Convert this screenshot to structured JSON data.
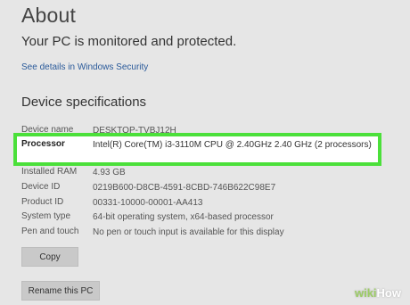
{
  "header": {
    "title": "About",
    "protection_status": "Your PC is monitored and protected.",
    "security_link": "See details in Windows Security"
  },
  "device_specs": {
    "heading": "Device specifications",
    "rows": [
      {
        "label": "Device name",
        "value": "DESKTOP-TVBJ12H"
      },
      {
        "label": "Processor",
        "value": "Intel(R) Core(TM) i3-3110M CPU @ 2.40GHz   2.40 GHz  (2 processors)"
      },
      {
        "label": "Installed RAM",
        "value": "4.93 GB"
      },
      {
        "label": "Device ID",
        "value": "0219B600-D8CB-4591-8CBD-746B622C98E7"
      },
      {
        "label": "Product ID",
        "value": "00331-10000-00001-AA413"
      },
      {
        "label": "System type",
        "value": "64-bit operating system, x64-based processor"
      },
      {
        "label": "Pen and touch",
        "value": "No pen or touch input is available for this display"
      }
    ]
  },
  "buttons": {
    "copy": "Copy",
    "rename": "Rename this PC"
  },
  "watermark": {
    "wiki": "wiki",
    "how": "How"
  },
  "colors": {
    "highlight_border": "#4be03a",
    "link": "#2a5a9a",
    "background": "#e6e6e6"
  }
}
